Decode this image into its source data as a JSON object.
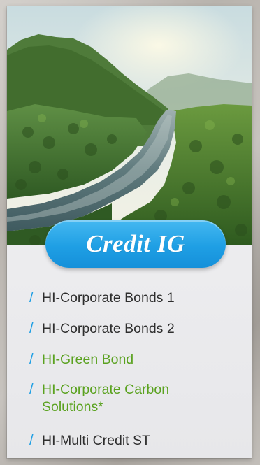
{
  "card": {
    "title": "Credit IG",
    "image_alt": "River flowing through green tropical forest and mountains",
    "colors": {
      "pill": "#1f9fe4",
      "slash": "#1f9fe4",
      "text_default": "#2e2e2e",
      "text_highlight": "#5aa21f"
    }
  },
  "funds": [
    {
      "slash": "/",
      "label": "HI-Corporate Bonds 1",
      "highlight": false
    },
    {
      "slash": "/",
      "label": "HI-Corporate Bonds 2",
      "highlight": false
    },
    {
      "slash": "/",
      "label": "HI-Green Bond",
      "highlight": true
    },
    {
      "slash": "/",
      "label": "HI-Corporate Carbon Solutions*",
      "highlight": true
    },
    {
      "slash": "/",
      "label": "HI-Multi Credit ST",
      "highlight": false
    }
  ]
}
